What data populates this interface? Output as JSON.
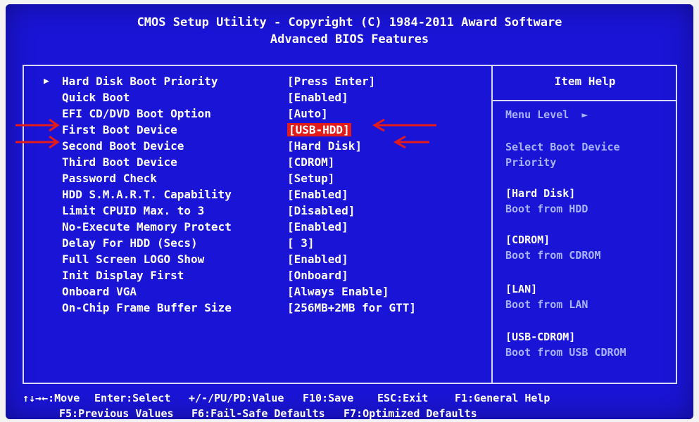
{
  "header": {
    "title": "CMOS Setup Utility - Copyright (C) 1984-2011 Award Software",
    "subtitle": "Advanced BIOS Features"
  },
  "settings": [
    {
      "label": "Hard Disk Boot Priority",
      "value": "[Press Enter]",
      "submenu": true
    },
    {
      "label": "Quick Boot",
      "value": "[Enabled]"
    },
    {
      "label": "EFI CD/DVD Boot Option",
      "value": "[Auto]"
    },
    {
      "label": "First Boot Device",
      "value": "[USB-HDD]",
      "selected": true
    },
    {
      "label": "Second Boot Device",
      "value": "[Hard Disk]"
    },
    {
      "label": "Third Boot Device",
      "value": "[CDROM]"
    },
    {
      "label": "Password Check",
      "value": "[Setup]"
    },
    {
      "label": "HDD S.M.A.R.T. Capability",
      "value": "[Enabled]"
    },
    {
      "label": "Limit CPUID Max. to 3",
      "value": "[Disabled]"
    },
    {
      "label": "No-Execute Memory Protect",
      "value": "[Enabled]"
    },
    {
      "label": "Delay For HDD (Secs)",
      "value": "[ 3]"
    },
    {
      "label": "Full Screen LOGO Show",
      "value": "[Enabled]"
    },
    {
      "label": "Init Display First",
      "value": "[Onboard]"
    },
    {
      "label": "Onboard VGA",
      "value": "[Always Enable]"
    },
    {
      "label": "On-Chip Frame Buffer Size",
      "value": "[256MB+2MB for GTT]"
    }
  ],
  "item_help": {
    "title": "Item Help",
    "menu_level": "Menu Level",
    "menu_level_marker": "►",
    "description": [
      "Select Boot Device",
      "Priority"
    ],
    "options": [
      {
        "name": "[Hard Disk]",
        "desc": "Boot from HDD"
      },
      {
        "name": "[CDROM]",
        "desc": "Boot from CDROM"
      },
      {
        "name": "[LAN]",
        "desc": "Boot from LAN"
      },
      {
        "name": "[USB-CDROM]",
        "desc": "Boot from USB CDROM"
      }
    ]
  },
  "footer": {
    "line1": [
      "↑↓→←:Move",
      "Enter:Select",
      "+/-/PU/PD:Value",
      "F10:Save",
      "ESC:Exit",
      "F1:General Help"
    ],
    "line2": [
      "F5:Previous Values",
      "F6:Fail-Safe Defaults",
      "F7:Optimized Defaults"
    ]
  },
  "colors": {
    "background": "#1a14d6",
    "highlight": "#e41b1b",
    "help_text": "#a9b3ff",
    "annotation_arrows": "#e41b1b"
  },
  "icons": {
    "submenu_marker": "triangle-right-icon",
    "annotation": "red-arrow-icon"
  }
}
